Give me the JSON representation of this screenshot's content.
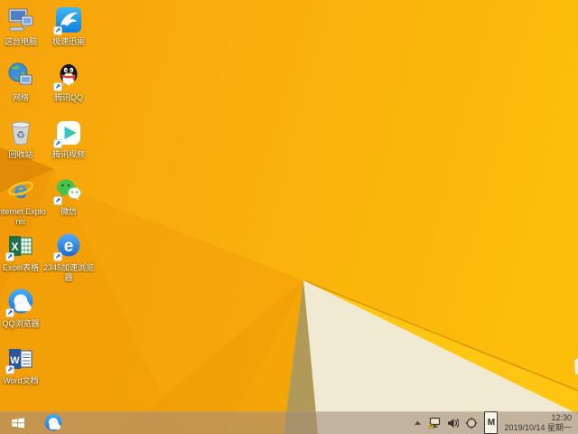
{
  "desktop": {
    "icons": [
      {
        "id": "this-pc",
        "label": "这台电脑"
      },
      {
        "id": "xunlei",
        "label": "极速迅雷"
      },
      {
        "id": "network",
        "label": "网络"
      },
      {
        "id": "tencent-qq",
        "label": "腾讯QQ"
      },
      {
        "id": "recycle-bin",
        "label": "回收站"
      },
      {
        "id": "tencent-video",
        "label": "腾讯视频"
      },
      {
        "id": "internet-explorer",
        "label": "Internet Explorer"
      },
      {
        "id": "wechat",
        "label": "微信"
      },
      {
        "id": "excel",
        "label": "Excel表格"
      },
      {
        "id": "2345-browser",
        "label": "2345加速浏览器"
      },
      {
        "id": "qq-browser",
        "label": "QQ浏览器"
      },
      {
        "id": "word",
        "label": "Word文档"
      }
    ]
  },
  "taskbar": {
    "tray": {
      "time": "12:30",
      "date": "2019/10/14 星期一",
      "ime_letter": "M"
    }
  },
  "icon_glyphs": {
    "ie": "e",
    "excel": "X",
    "word": "W",
    "b2345": "e",
    "recycle": "♻"
  },
  "colors": {
    "amber-left": "#F6A30C",
    "amber-right": "#FCBD0B",
    "gold-band": "#FFC513",
    "cream-facet": "#F1EAD3",
    "tan-shadow": "#AF9A59",
    "dark-wedge": "#E28B06",
    "taskbar-tan": "#C39B50"
  }
}
